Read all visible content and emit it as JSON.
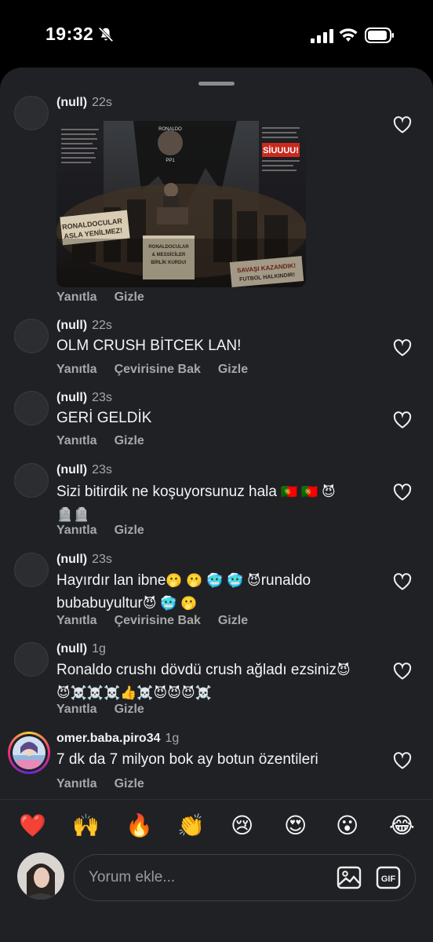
{
  "status_bar": {
    "time": "19:32"
  },
  "comments": [
    {
      "user": "(null)",
      "time": "22s",
      "text": "",
      "actions": [
        "Yanıtla",
        "Gizle"
      ]
    },
    {
      "user": "(null)",
      "time": "22s",
      "text": "OLM CRUSH BİTCEK LAN!",
      "actions": [
        "Yanıtla",
        "Çevirisine Bak",
        "Gizle"
      ]
    },
    {
      "user": "(null)",
      "time": "23s",
      "text": "GERİ GELDİK",
      "actions": [
        "Yanıtla",
        "Gizle"
      ]
    },
    {
      "user": "(null)",
      "time": "23s",
      "text_line1": "Sizi  bitirdik ne koşuyorsunuz hala",
      "emoji_line1": "🇵🇹 🇵🇹 😈",
      "emoji_line2": "🪦🪦",
      "actions": [
        "Yanıtla",
        "Gizle"
      ]
    },
    {
      "user": "(null)",
      "time": "23s",
      "text_a": "Hayırdır lan ibne",
      "emoji_a": "🫢 🫢 🥶 🥶 😈",
      "text_b": "runaldo",
      "text_c": "bubabuyultur",
      "emoji_c": "😈 🥶 🫢",
      "actions": [
        "Yanıtla",
        "Çevirisine Bak",
        "Gizle"
      ]
    },
    {
      "user": "(null)",
      "time": "1g",
      "text_a": "Ronaldo crushı dövdü crush ağladı ezsiniz",
      "emoji_a": "😈",
      "emoji_line2": "😈☠️☠️☠️👍☠️😈😈😈☠️",
      "actions": [
        "Yanıtla",
        "Gizle"
      ]
    },
    {
      "user": "omer.baba.piro34",
      "time": "1g",
      "text": "7 dk da 7 milyon bok ay botun özentileri",
      "actions": [
        "Yanıtla",
        "Gizle"
      ]
    }
  ],
  "post_image": {
    "left_text": "Ronaldocular asla yenilmez!",
    "right_text_header": "SİUUUU!",
    "banner": "Ronaldocular & Messiciler birlik kurdu!",
    "bottom_right": "Savaşı kazandık! Futbol halkındır!",
    "top_label": "Ronaldo PP1"
  },
  "reactions": [
    "❤️",
    "🙌",
    "🔥",
    "👏",
    "😢",
    "😍",
    "😮",
    "😂"
  ],
  "input": {
    "placeholder": "Yorum ekle...",
    "gif_label": "GIF"
  },
  "icons": {
    "heart": "heart-icon",
    "image": "image-icon",
    "gif": "gif-icon"
  }
}
